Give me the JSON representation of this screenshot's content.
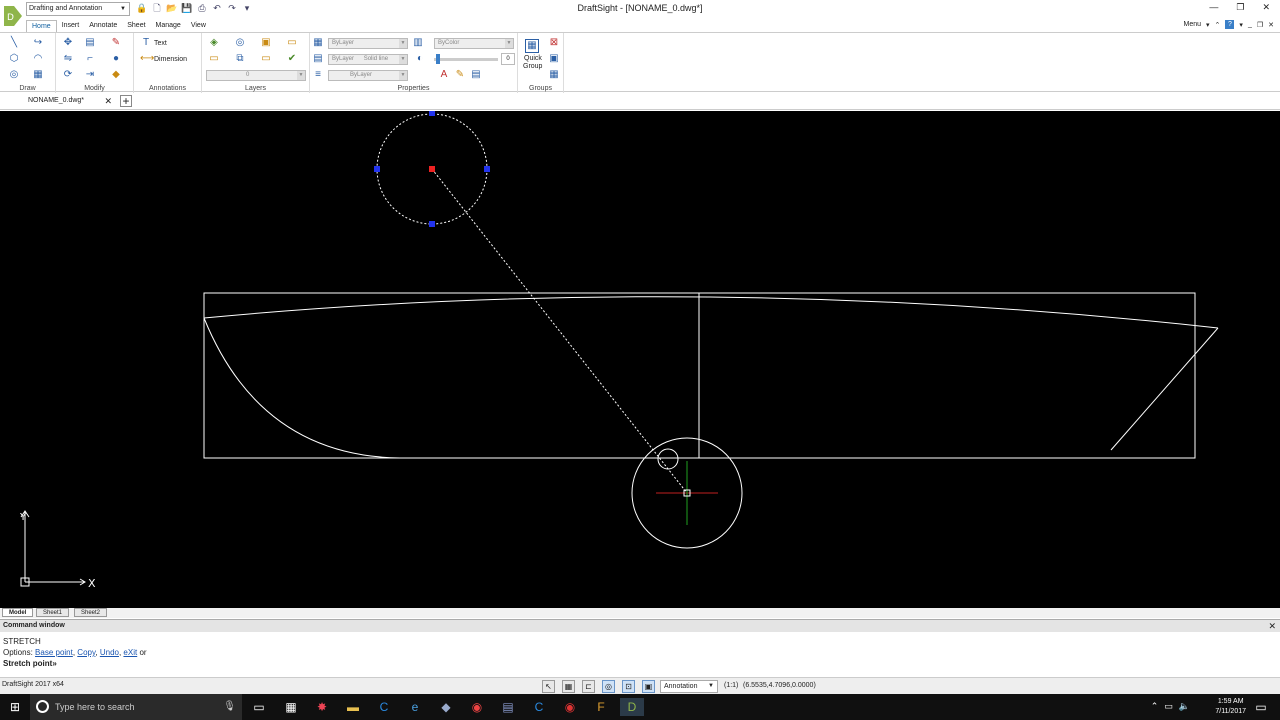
{
  "titlebar": {
    "workspace": "Drafting and Annotation",
    "window_title": "DraftSight - [NONAME_0.dwg*]"
  },
  "menu": {
    "tabs": [
      "Home",
      "Insert",
      "Annotate",
      "Sheet",
      "Manage",
      "View"
    ],
    "menu_label": "Menu"
  },
  "ribbon": {
    "groups": {
      "draw": "Draw",
      "modify": "Modify",
      "annotations": "Annotations",
      "layers": "Layers",
      "properties": "Properties",
      "groups": "Groups"
    },
    "text_label": "Text",
    "dimension_label": "Dimension",
    "layer_value": "0",
    "color_value": "ByLayer",
    "color2_value": "ByColor",
    "linetype_value": "ByLayer",
    "linestyle_value": "Solid line",
    "lineweight_value": "ByLayer",
    "transparency_value": "0",
    "quick_group_label_1": "Quick",
    "quick_group_label_2": "Group"
  },
  "document": {
    "tab_name": "NONAME_0.dwg*"
  },
  "sheets": [
    "Model",
    "Sheet1",
    "Sheet2"
  ],
  "command": {
    "title": "Command window",
    "line1": "STRETCH",
    "options_prefix": "Options:",
    "options": [
      "Base point",
      "Copy",
      "Undo",
      "eXit"
    ],
    "options_suffix": "or",
    "prompt": "Stretch point»"
  },
  "status": {
    "app": "DraftSight 2017 x64",
    "annotation": "Annotation",
    "scale": "(1:1)",
    "coords": "(6.5535,4.7096,0.0000)"
  },
  "ucs": {
    "x_label": "X",
    "y_label": "Y"
  },
  "taskbar": {
    "search_placeholder": "Type here to search",
    "time": "1:59 AM",
    "date": "7/11/2017"
  }
}
